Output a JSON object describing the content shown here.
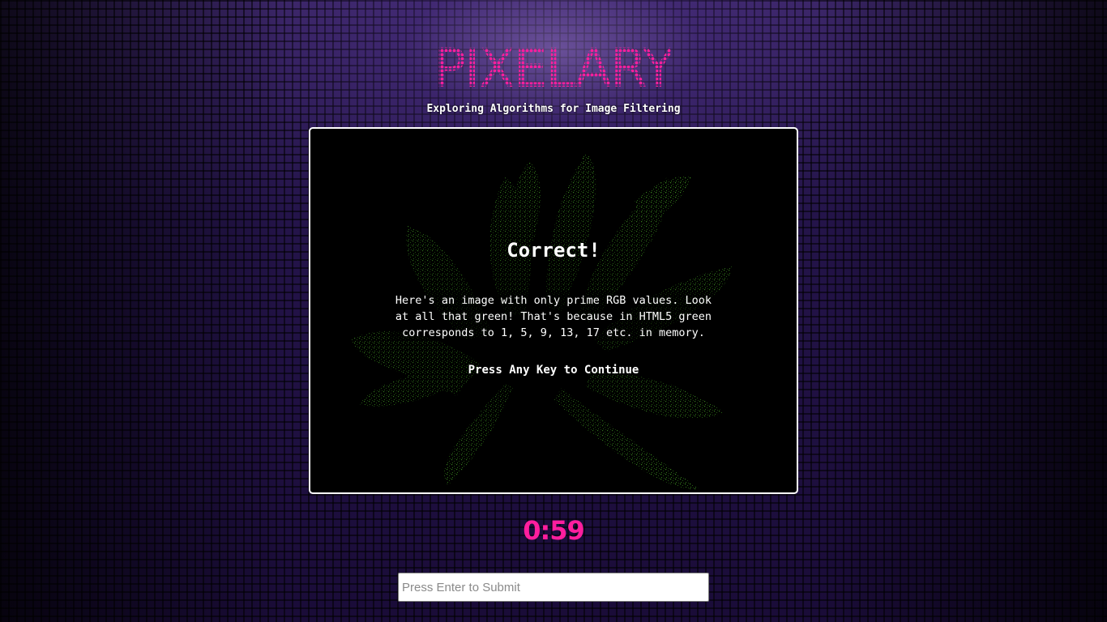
{
  "app": {
    "logo_text": "PIXELARY",
    "subtitle": "Exploring Algorithms for Image Filtering"
  },
  "message": {
    "title": "Correct!",
    "body": "Here's an image with only prime RGB values. Look at all that green! That's because in HTML5 green corresponds to 1, 5, 9, 13, 17 etc. in memory.",
    "continue": "Press Any Key to Continue"
  },
  "timer": {
    "value": "0:59"
  },
  "answer": {
    "placeholder": "Press Enter to Submit",
    "value": ""
  },
  "colors": {
    "accent": "#ff1e9e",
    "flower_green": "#3b7f1c",
    "frame_border": "#ffffff"
  }
}
